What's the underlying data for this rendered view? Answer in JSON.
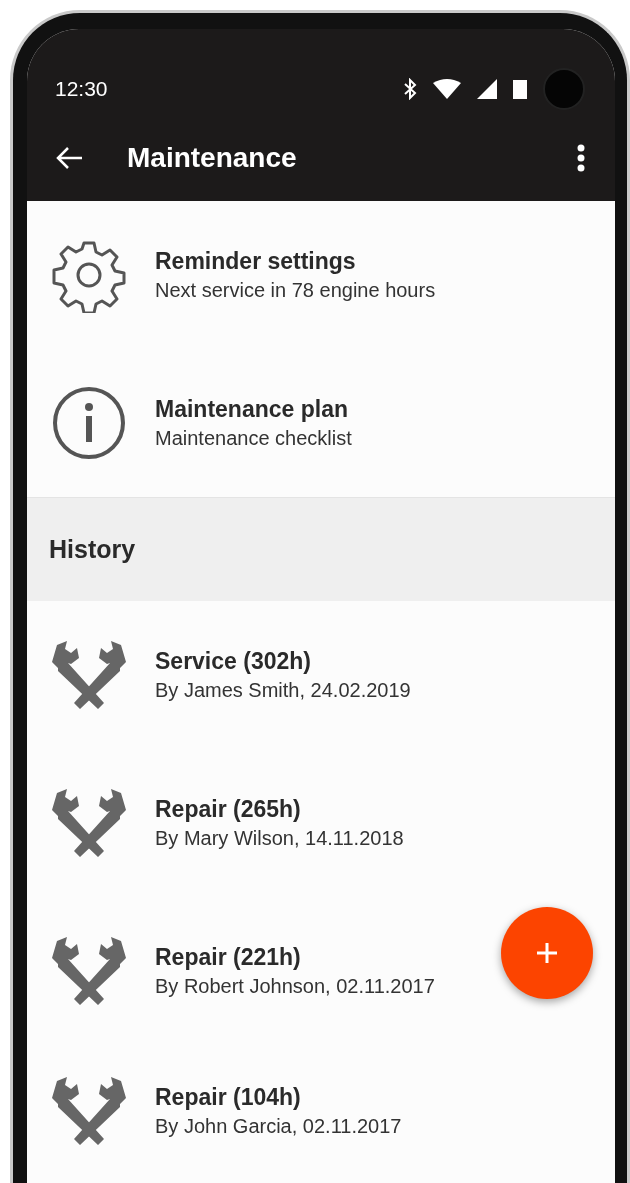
{
  "status_bar": {
    "time": "12:30"
  },
  "app_bar": {
    "title": "Maintenance"
  },
  "menu_items": [
    {
      "kind": "settings",
      "title": "Reminder settings",
      "subtitle": "Next service in 78 engine hours"
    },
    {
      "kind": "info",
      "title": "Maintenance plan",
      "subtitle": "Maintenance checklist"
    }
  ],
  "history": {
    "header": "History",
    "items": [
      {
        "title": "Service (302h)",
        "subtitle": "By James Smith, 24.02.2019"
      },
      {
        "title": "Repair (265h)",
        "subtitle": "By Mary Wilson, 14.11.2018"
      },
      {
        "title": "Repair (221h)",
        "subtitle": "By Robert Johnson, 02.11.2017"
      },
      {
        "title": "Repair (104h)",
        "subtitle": "By John Garcia, 02.11.2017"
      }
    ]
  }
}
